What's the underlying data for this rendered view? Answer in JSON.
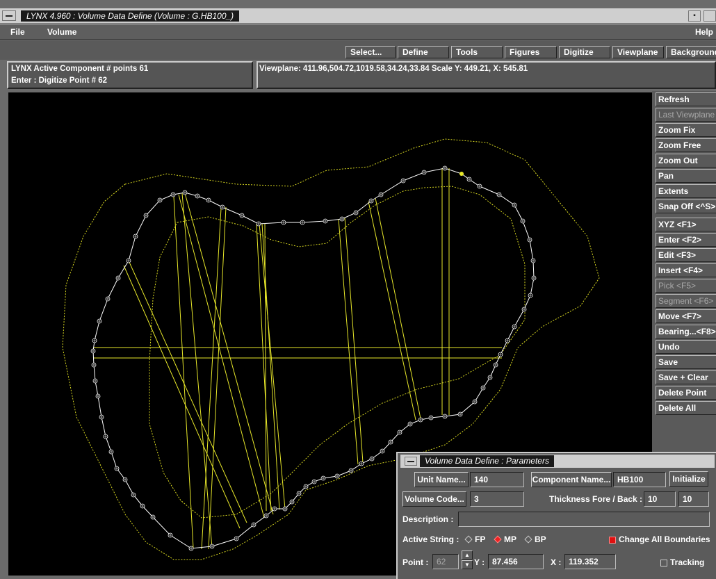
{
  "window": {
    "title": "LYNX 4.960 : Volume Data Define (Volume : G.HB100_)"
  },
  "menubar": {
    "file": "File",
    "volume": "Volume",
    "help": "Help"
  },
  "toolbar": {
    "items": [
      "Select...",
      "Define",
      "Tools",
      "Figures",
      "Digitize",
      "Viewplane",
      "Background"
    ]
  },
  "status": {
    "line1": "LYNX Active Component # points 61",
    "line2": "Enter : Digitize Point # 62",
    "viewplane": "Viewplane: 411.96,504.72,1019.58,34.24,33.84 Scale Y: 449.21, X: 545.81"
  },
  "sidebar": {
    "buttons": [
      {
        "label": "Refresh",
        "enabled": true
      },
      {
        "label": "Last Viewplane",
        "enabled": false
      },
      {
        "label": "Zoom Fix",
        "enabled": true
      },
      {
        "label": "Zoom Free",
        "enabled": true
      },
      {
        "label": "Zoom Out",
        "enabled": true
      },
      {
        "label": "Pan",
        "enabled": true
      },
      {
        "label": "Extents",
        "enabled": true
      },
      {
        "label": "Snap Off <^S>",
        "enabled": true
      },
      {
        "label": "XYZ <F1>",
        "enabled": true
      },
      {
        "label": "Enter <F2>",
        "enabled": true
      },
      {
        "label": "Edit <F3>",
        "enabled": true
      },
      {
        "label": "Insert <F4>",
        "enabled": true
      },
      {
        "label": "Pick <F5>",
        "enabled": false
      },
      {
        "label": "Segment <F6>",
        "enabled": false
      },
      {
        "label": "Move <F7>",
        "enabled": true
      },
      {
        "label": "Bearing...<F8>",
        "enabled": true
      },
      {
        "label": "Undo",
        "enabled": true
      },
      {
        "label": "Save",
        "enabled": true
      },
      {
        "label": "Save + Clear",
        "enabled": true
      },
      {
        "label": "Delete Point",
        "enabled": true
      },
      {
        "label": "Delete All",
        "enabled": true
      }
    ]
  },
  "dialog": {
    "title": "Volume Data Define : Parameters",
    "unit_name_button": "Unit Name...",
    "unit_name_value": "140",
    "component_name_button": "Component Name...",
    "component_name_value": "HB100",
    "initialize_button": "Initialize",
    "volume_code_button": "Volume Code...",
    "volume_code_value": "3",
    "thickness_label": "Thickness Fore / Back :",
    "thickness_fore": "10",
    "thickness_back": "10",
    "description_label": "Description :",
    "description_value": "",
    "active_string_label": "Active String :",
    "active_string_options": [
      "FP",
      "MP",
      "BP"
    ],
    "active_string_selected": "MP",
    "change_all_label": "Change All Boundaries",
    "change_all_checked": true,
    "point_label": "Point :",
    "point_value": "62",
    "y_label": "Y :",
    "y_value": "87.456",
    "x_label": "X :",
    "x_value": "119.352",
    "tracking_label": "Tracking",
    "tracking_checked": false
  },
  "colors": {
    "canvas_bg": "#000000",
    "outline": "#ffffff",
    "string_lines": "#e8e82a",
    "boundary_dotted": "#d8d820"
  }
}
